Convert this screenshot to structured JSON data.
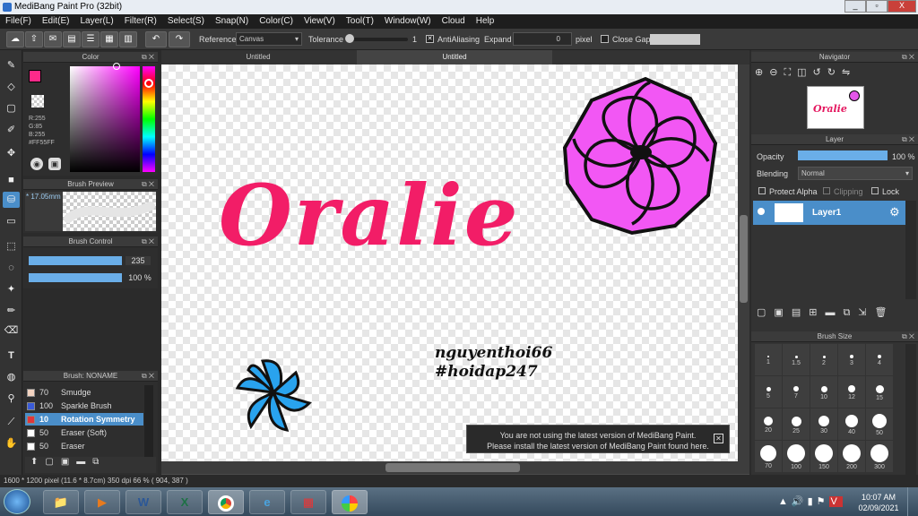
{
  "window": {
    "title": "MediBang Paint Pro (32bit)",
    "min": "_",
    "max": "▫",
    "close": "X"
  },
  "menu": [
    "File(F)",
    "Edit(E)",
    "Layer(L)",
    "Filter(R)",
    "Select(S)",
    "Snap(N)",
    "Color(C)",
    "View(V)",
    "Tool(T)",
    "Window(W)",
    "Cloud",
    "Help"
  ],
  "toolbar": {
    "reference_label": "Reference",
    "reference_value": "Canvas",
    "tolerance_label": "Tolerance",
    "tolerance_value": "1",
    "antialiasing_label": "AntiAliasing",
    "expand_label": "Expand",
    "expand_value": "0",
    "expand_unit": "pixel",
    "close_gaps_label": "Close Gaps"
  },
  "color_panel": {
    "title": "Color",
    "r": "R:255",
    "g": "G:85",
    "b": "B:255",
    "hex": "#FF55FF",
    "fg": "#ff2a8a"
  },
  "brush_preview": {
    "title": "Brush Preview",
    "size": "17.05mm"
  },
  "brush_control": {
    "title": "Brush Control",
    "size": "235",
    "opacity": "100 %"
  },
  "brush_list": {
    "title": "Brush: NONAME",
    "items": [
      {
        "size": "70",
        "name": "Smudge",
        "color": "#f3d3c0"
      },
      {
        "size": "100",
        "name": "Sparkle Brush",
        "color": "#3a5bd8"
      },
      {
        "size": "10",
        "name": "Rotation Symmetry",
        "color": "#e0363a"
      },
      {
        "size": "50",
        "name": "Eraser (Soft)",
        "color": "#ffffff"
      },
      {
        "size": "50",
        "name": "Eraser",
        "color": "#ffffff"
      }
    ]
  },
  "tabs": [
    "Untitled",
    "Untitled"
  ],
  "canvas": {
    "word": "Oralie",
    "line1": "nguyenthoi66",
    "line2": "#hoidap247"
  },
  "notice": {
    "line1": "You are not using the latest version of MediBang Paint.",
    "line2": "Please install the latest version of MediBang Paint found here.",
    "close": "✕"
  },
  "navigator": {
    "title": "Navigator",
    "thumb": "Oralie"
  },
  "layer": {
    "title": "Layer",
    "opacity_label": "Opacity",
    "opacity_value": "100 %",
    "opacity_fraction": 1.0,
    "blending_label": "Blending",
    "blending_value": "Normal",
    "protect_alpha": "Protect Alpha",
    "clipping": "Clipping",
    "lock": "Lock",
    "layer_name": "Layer1"
  },
  "brush_size": {
    "title": "Brush Size",
    "sizes": [
      "1",
      "1.5",
      "2",
      "3",
      "4",
      "5",
      "7",
      "10",
      "12",
      "15",
      "20",
      "25",
      "30",
      "40",
      "50",
      "70",
      "100",
      "150",
      "200",
      "300"
    ]
  },
  "status": "1600 * 1200 pixel  (11.6 * 8.7cm)  350 dpi  66 %  ( 904, 387 )",
  "clock": {
    "time": "10:07 AM",
    "date": "02/09/2021"
  }
}
